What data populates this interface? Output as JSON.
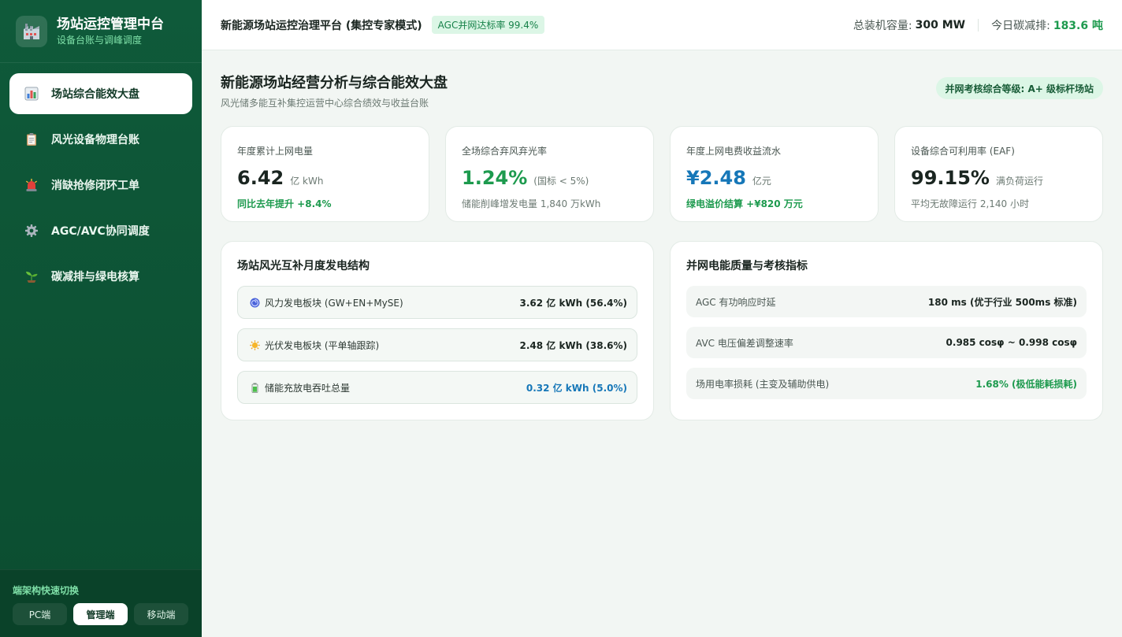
{
  "brand": {
    "title": "场站运控管理中台",
    "subtitle": "设备台账与调峰调度",
    "logo_icon": "factory-icon"
  },
  "sidebar": {
    "items": [
      {
        "label": "场站综合能效大盘",
        "icon": "chart-icon",
        "active": true
      },
      {
        "label": "风光设备物理台账",
        "icon": "clipboard-icon",
        "active": false
      },
      {
        "label": "消缺抢修闭环工单",
        "icon": "alarm-light-icon",
        "active": false
      },
      {
        "label": "AGC/AVC协同调度",
        "icon": "gear-icon",
        "active": false
      },
      {
        "label": "碳减排与绿电核算",
        "icon": "seedling-icon",
        "active": false
      }
    ],
    "switcher": {
      "title": "端架构快速切换",
      "options": [
        "PC端",
        "管理端",
        "移动端"
      ],
      "active": "管理端"
    }
  },
  "header": {
    "title": "新能源场站运控治理平台 (集控专家模式)",
    "badge": "AGC并网达标率 99.4%",
    "capacity_label": "总装机容量:",
    "capacity_value": "300 MW",
    "carbon_label": "今日碳减排:",
    "carbon_value": "183.6 吨"
  },
  "page": {
    "title": "新能源场站经营分析与综合能效大盘",
    "subtitle": "风光储多能互补集控运营中心综合绩效与收益台账",
    "grade": "并网考核综合等级: A+ 级标杆场站"
  },
  "kpis": [
    {
      "label": "年度累计上网电量",
      "value": "6.42",
      "unit": "亿 kWh",
      "foot": "同比去年提升 +8.4%",
      "value_color": "dark",
      "foot_style": "green"
    },
    {
      "label": "全场综合弃风弃光率",
      "value": "1.24%",
      "unit": "(国标 < 5%)",
      "foot": "储能削峰增发电量 1,840 万kWh",
      "value_color": "green",
      "foot_style": "muted"
    },
    {
      "label": "年度上网电费收益流水",
      "value": "¥2.48",
      "unit": "亿元",
      "foot": "绿电溢价结算 +¥820 万元",
      "value_color": "blue",
      "foot_style": "green"
    },
    {
      "label": "设备综合可利用率 (EAF)",
      "value": "99.15%",
      "unit": "满负荷运行",
      "foot": "平均无故障运行 2,140 小时",
      "value_color": "dark",
      "foot_style": "muted"
    }
  ],
  "mix_panel": {
    "title": "场站风光互补月度发电结构",
    "rows": [
      {
        "icon": "wind-swirl-icon",
        "name": "风力发电板块 (GW+EN+MySE)",
        "value": "3.62 亿 kWh (56.4%)",
        "color": "dark"
      },
      {
        "icon": "sun-icon",
        "name": "光伏发电板块 (平单轴跟踪)",
        "value": "2.48 亿 kWh (38.6%)",
        "color": "dark"
      },
      {
        "icon": "battery-icon",
        "name": "储能充放电吞吐总量",
        "value": "0.32 亿 kWh (5.0%)",
        "color": "blue"
      }
    ]
  },
  "quality_panel": {
    "title": "并网电能质量与考核指标",
    "rows": [
      {
        "name": "AGC 有功响应时延",
        "value": "180 ms (优于行业 500ms 标准)",
        "color": "dark"
      },
      {
        "name": "AVC 电压偏差调整速率",
        "value": "0.985 cosφ ~ 0.998 cosφ",
        "color": "dark"
      },
      {
        "name": "场用电率损耗 (主变及辅助供电)",
        "value": "1.68% (极低能耗损耗)",
        "color": "green"
      }
    ]
  },
  "colors": {
    "sidebar": "#0f5a3a",
    "accent_green": "#1d9a4e",
    "accent_blue": "#1677b8"
  }
}
